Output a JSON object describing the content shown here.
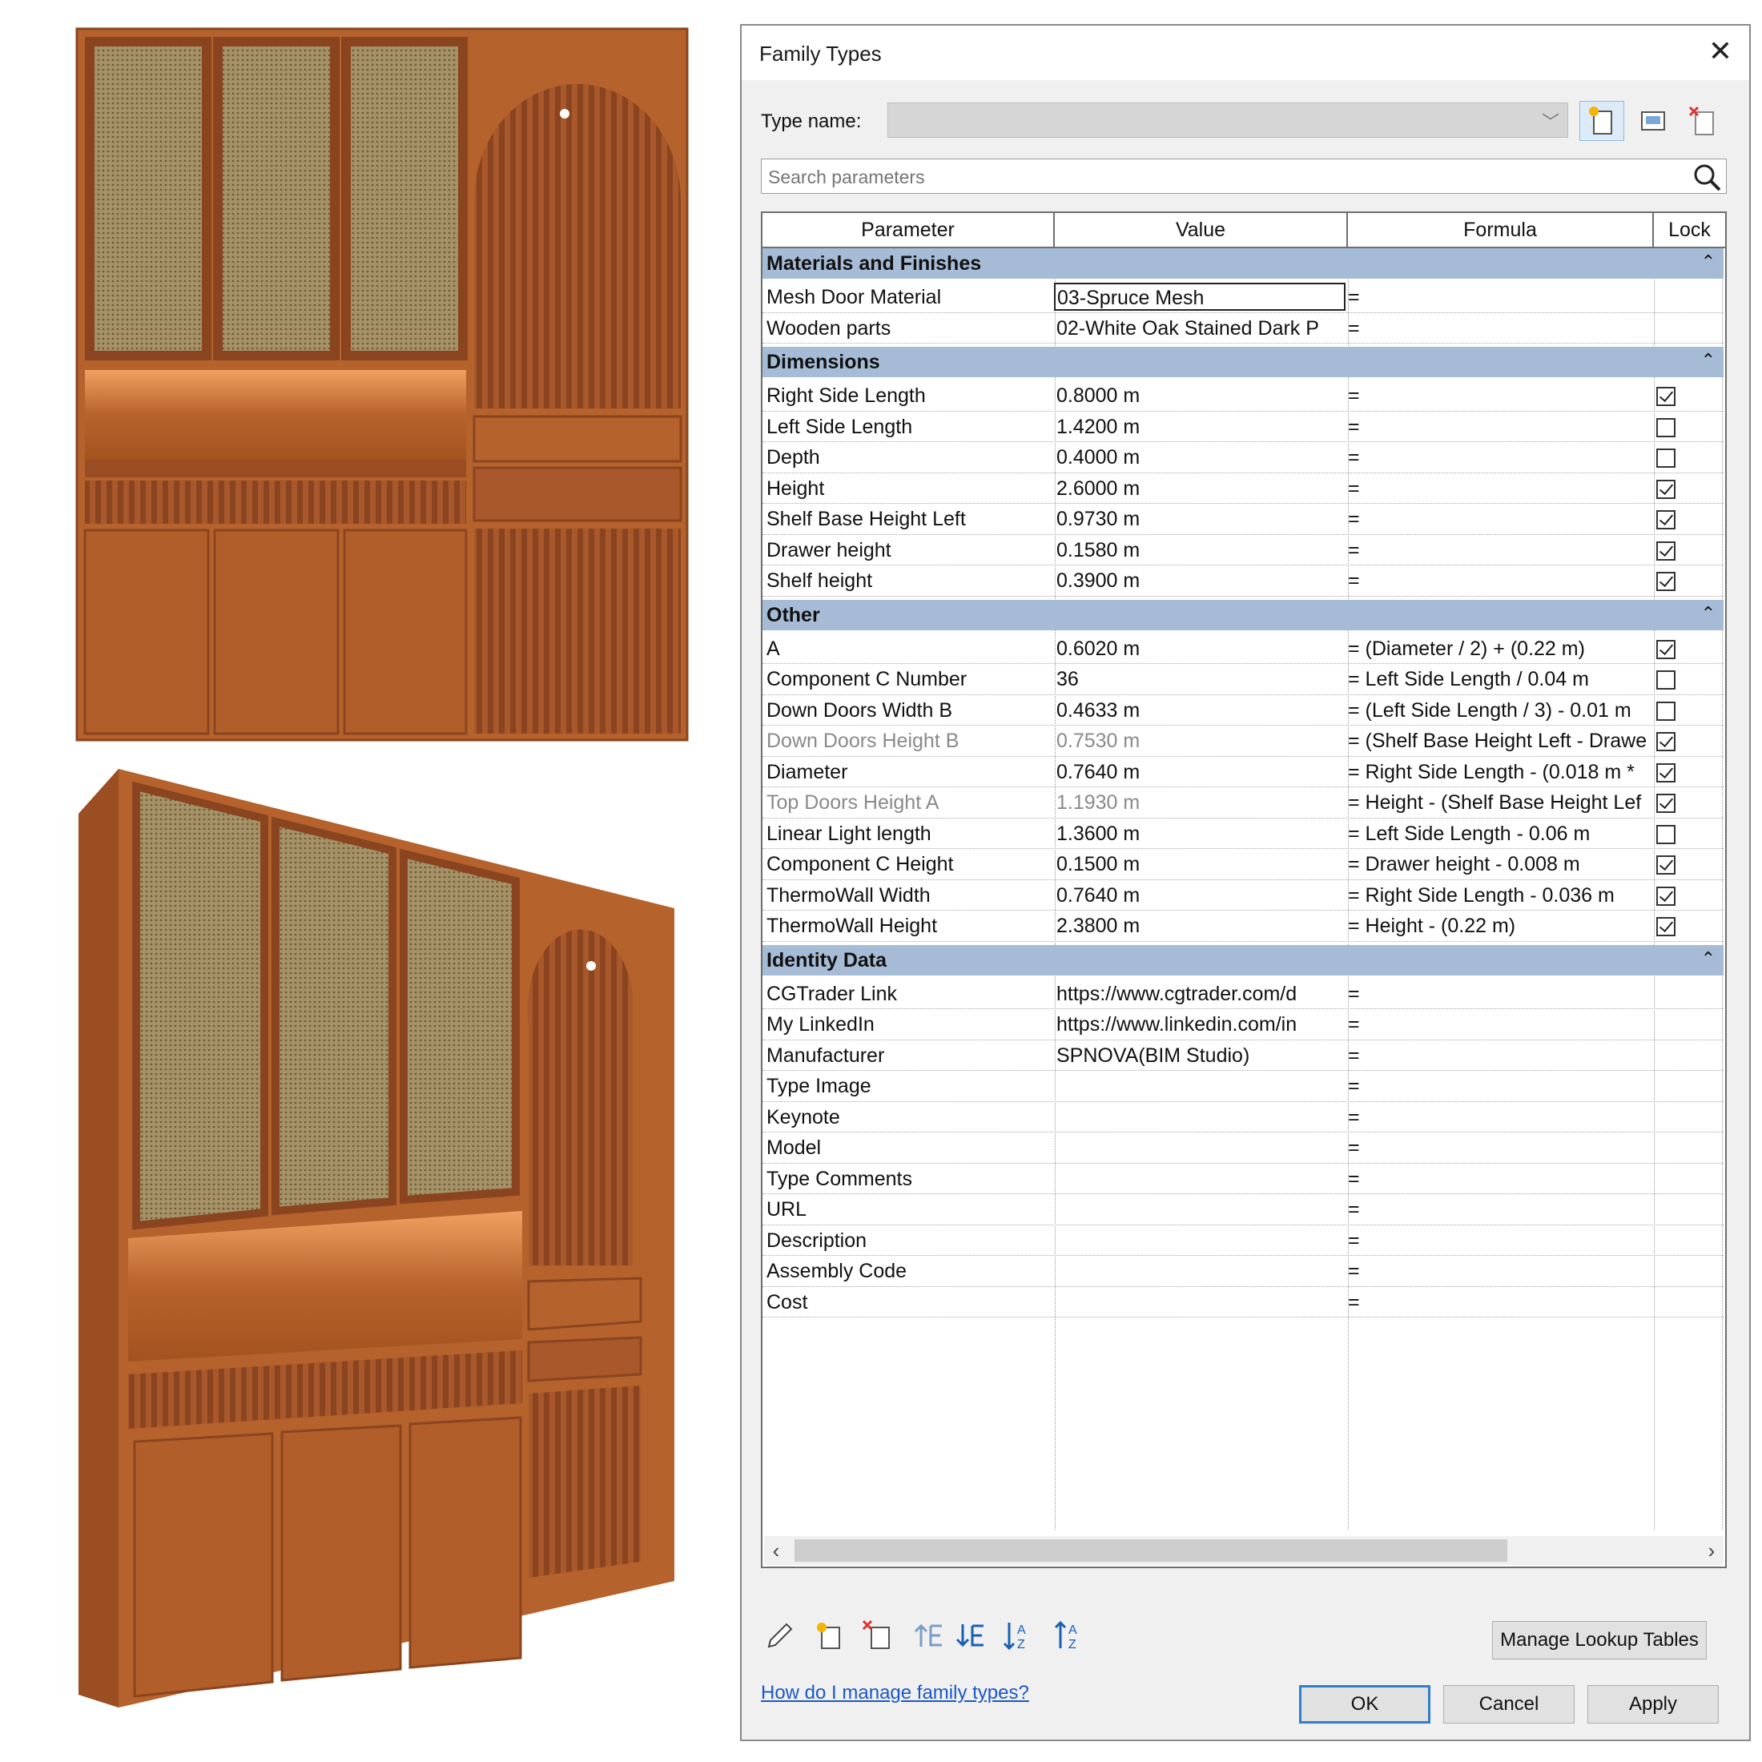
{
  "dialog": {
    "title": "Family Types",
    "type_name_label": "Type name:",
    "type_name_value": "",
    "search_placeholder": "Search parameters",
    "columns": [
      "Parameter",
      "Value",
      "Formula",
      "Lock"
    ],
    "groups": [
      {
        "name": "Materials and Finishes",
        "rows": [
          {
            "parameter": "Mesh Door Material",
            "value": "03-Spruce Mesh",
            "formula": "=",
            "lock": null
          },
          {
            "parameter": "Wooden parts",
            "value": "02-White Oak Stained Dark P",
            "formula": "=",
            "lock": null
          }
        ]
      },
      {
        "name": "Dimensions",
        "rows": [
          {
            "parameter": "Right Side Length",
            "value": "0.8000 m",
            "formula": "=",
            "lock": true
          },
          {
            "parameter": "Left Side Length",
            "value": "1.4200 m",
            "formula": "=",
            "lock": false
          },
          {
            "parameter": "Depth",
            "value": "0.4000 m",
            "formula": "=",
            "lock": false
          },
          {
            "parameter": "Height",
            "value": "2.6000 m",
            "formula": "=",
            "lock": true
          },
          {
            "parameter": "Shelf Base Height Left",
            "value": "0.9730 m",
            "formula": "=",
            "lock": true
          },
          {
            "parameter": "Drawer height",
            "value": "0.1580 m",
            "formula": "=",
            "lock": true
          },
          {
            "parameter": "Shelf height",
            "value": "0.3900 m",
            "formula": "=",
            "lock": true
          }
        ]
      },
      {
        "name": "Other",
        "rows": [
          {
            "parameter": "A",
            "value": "0.6020 m",
            "formula": "= (Diameter / 2) + (0.22 m)",
            "lock": true
          },
          {
            "parameter": "Component C Number",
            "value": "36",
            "formula": "= Left Side Length / 0.04 m",
            "lock": false
          },
          {
            "parameter": "Down Doors Width B",
            "value": "0.4633 m",
            "formula": "= (Left Side Length / 3) - 0.01 m",
            "lock": false
          },
          {
            "parameter": "Down Doors Height B",
            "value": "0.7530 m",
            "formula": "= (Shelf Base Height Left - Drawe",
            "lock": true,
            "dim": true
          },
          {
            "parameter": "Diameter",
            "value": "0.7640 m",
            "formula": "= Right Side Length - (0.018 m *",
            "lock": true
          },
          {
            "parameter": "Top Doors Height A",
            "value": "1.1930 m",
            "formula": "= Height - (Shelf Base Height Lef",
            "lock": true,
            "dim": true
          },
          {
            "parameter": "Linear Light length",
            "value": "1.3600 m",
            "formula": "= Left Side Length - 0.06 m",
            "lock": false
          },
          {
            "parameter": "Component C Height",
            "value": "0.1500 m",
            "formula": "= Drawer height - 0.008 m",
            "lock": true
          },
          {
            "parameter": "ThermoWall Width",
            "value": "0.7640 m",
            "formula": "= Right Side Length - 0.036 m",
            "lock": true
          },
          {
            "parameter": "ThermoWall Height",
            "value": "2.3800 m",
            "formula": "= Height - (0.22 m)",
            "lock": true
          }
        ]
      },
      {
        "name": "Identity Data",
        "rows": [
          {
            "parameter": "CGTrader Link",
            "value": "https://www.cgtrader.com/d",
            "formula": "=",
            "lock": null
          },
          {
            "parameter": "My LinkedIn",
            "value": "https://www.linkedin.com/in",
            "formula": "=",
            "lock": null
          },
          {
            "parameter": "Manufacturer",
            "value": "SPNOVA(BIM Studio)",
            "formula": "=",
            "lock": null
          },
          {
            "parameter": "Type Image",
            "value": "",
            "formula": "=",
            "lock": null
          },
          {
            "parameter": "Keynote",
            "value": "",
            "formula": "=",
            "lock": null
          },
          {
            "parameter": "Model",
            "value": "",
            "formula": "=",
            "lock": null
          },
          {
            "parameter": "Type Comments",
            "value": "",
            "formula": "=",
            "lock": null
          },
          {
            "parameter": "URL",
            "value": "",
            "formula": "=",
            "lock": null
          },
          {
            "parameter": "Description",
            "value": "",
            "formula": "=",
            "lock": null
          },
          {
            "parameter": "Assembly Code",
            "value": "",
            "formula": "=",
            "lock": null
          },
          {
            "parameter": "Cost",
            "value": "",
            "formula": "=",
            "lock": null
          }
        ]
      }
    ],
    "toolbar_icons": [
      "edit-pencil-icon",
      "new-parameter-icon",
      "delete-parameter-icon",
      "move-up-icon",
      "move-down-icon",
      "sort-ascending-icon",
      "sort-descending-icon"
    ],
    "manage_lookup_label": "Manage Lookup Tables",
    "help_link": "How do I manage family types?",
    "ok_label": "OK",
    "cancel_label": "Cancel",
    "apply_label": "Apply"
  },
  "colors": {
    "group_header": "#a6bcd6",
    "wood": "#b5622c",
    "link": "#1a57c9",
    "ok_border": "#2f7fcc"
  }
}
